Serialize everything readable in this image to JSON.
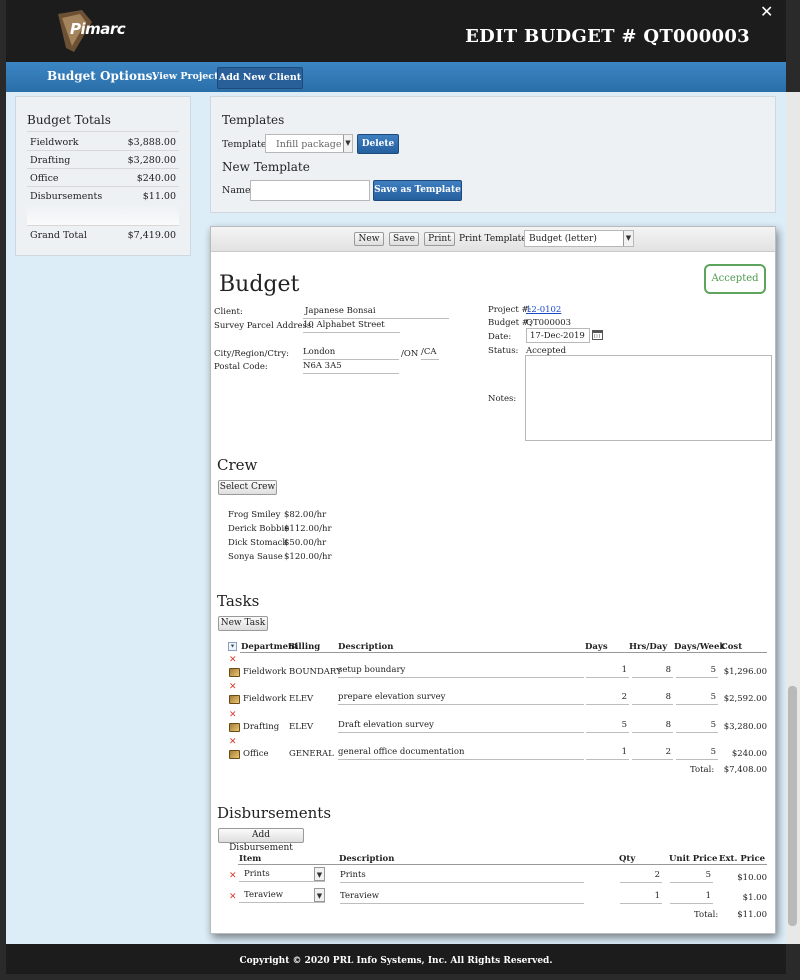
{
  "header": {
    "logo_text": "Pimarc",
    "title": "EDIT BUDGET # QT000003"
  },
  "options": {
    "label": "Budget Options:",
    "view_project": "View Project",
    "add_client": "Add New Client"
  },
  "totals": {
    "title": "Budget Totals",
    "rows": [
      {
        "label": "Fieldwork",
        "value": "$3,888.00"
      },
      {
        "label": "Drafting",
        "value": "$3,280.00"
      },
      {
        "label": "Office",
        "value": "$240.00"
      },
      {
        "label": "Disbursements",
        "value": "$11.00"
      }
    ],
    "grand_label": "Grand Total",
    "grand_value": "$7,419.00"
  },
  "templates": {
    "title": "Templates",
    "template_label": "Template",
    "template_value": "Infill package",
    "delete": "Delete",
    "new_title": "New Template",
    "name_label": "Name",
    "name_value": "",
    "save": "Save as Template"
  },
  "toolbar": {
    "new": "New",
    "save": "Save",
    "print": "Print",
    "print_templates_label": "Print Templates:",
    "print_template_value": "Budget (letter)"
  },
  "budget": {
    "title": "Budget",
    "status_badge": "Accepted",
    "client_label": "Client:",
    "client": "Japanese Bonsai",
    "survey_label": "Survey Parcel Address:",
    "survey": "10 Alphabet Street",
    "city_label": "City/Region/Ctry:",
    "city": "London",
    "region": "/ON",
    "country": "/CA",
    "postal_label": "Postal Code:",
    "postal": "N6A 3A5",
    "project_label": "Project #:",
    "project": "12-0102",
    "budget_no_label": "Budget #:",
    "budget_no": "QT000003",
    "date_label": "Date:",
    "date": "17-Dec-2019",
    "status_label": "Status:",
    "status": "Accepted",
    "notes_label": "Notes:",
    "notes": ""
  },
  "crew": {
    "title": "Crew",
    "select": "Select Crew",
    "members": [
      {
        "name": "Frog Smiley",
        "rate": "$82.00/hr"
      },
      {
        "name": "Derick Bobbie",
        "rate": "$112.00/hr"
      },
      {
        "name": "Dick Stomack",
        "rate": "$50.00/hr"
      },
      {
        "name": "Sonya Sause",
        "rate": "$120.00/hr"
      }
    ]
  },
  "tasks": {
    "title": "Tasks",
    "new": "New Task",
    "headers": {
      "dept": "Department",
      "billing": "Billing",
      "desc": "Description",
      "days": "Days",
      "hrs": "Hrs/Day",
      "dpw": "Days/Week",
      "cost": "Cost"
    },
    "rows": [
      {
        "dept": "Fieldwork",
        "billing": "BOUNDARY",
        "desc": "setup boundary",
        "days": "1",
        "hrs": "8",
        "dpw": "5",
        "cost": "$1,296.00"
      },
      {
        "dept": "Fieldwork",
        "billing": "ELEV",
        "desc": "prepare elevation survey",
        "days": "2",
        "hrs": "8",
        "dpw": "5",
        "cost": "$2,592.00"
      },
      {
        "dept": "Drafting",
        "billing": "ELEV",
        "desc": "Draft elevation survey",
        "days": "5",
        "hrs": "8",
        "dpw": "5",
        "cost": "$3,280.00"
      },
      {
        "dept": "Office",
        "billing": "GENERAL",
        "desc": "general office documentation",
        "days": "1",
        "hrs": "2",
        "dpw": "5",
        "cost": "$240.00"
      }
    ],
    "total_label": "Total:",
    "total": "$7,408.00"
  },
  "disb": {
    "title": "Disbursements",
    "add": "Add Disbursement",
    "headers": {
      "item": "Item",
      "desc": "Description",
      "qty": "Qty",
      "unit": "Unit Price",
      "ext": "Ext. Price"
    },
    "rows": [
      {
        "item": "Prints",
        "desc": "Prints",
        "qty": "2",
        "unit": "5",
        "ext": "$10.00"
      },
      {
        "item": "Teraview",
        "desc": "Teraview",
        "qty": "1",
        "unit": "1",
        "ext": "$1.00"
      }
    ],
    "total_label": "Total:",
    "total": "$11.00"
  },
  "footer": {
    "copyright": "Copyright © 2020 PRL Info Systems, Inc. All Rights Reserved."
  }
}
